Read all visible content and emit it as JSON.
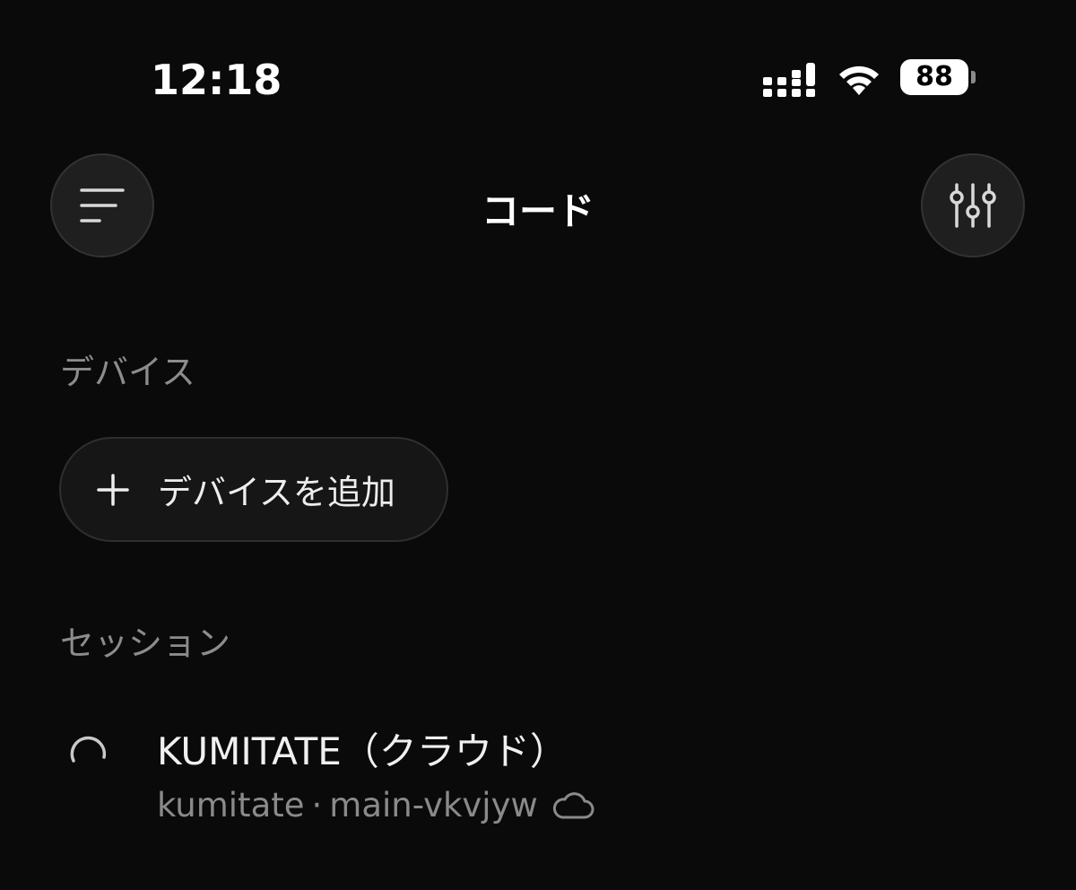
{
  "status_bar": {
    "time": "12:18",
    "battery_level": "88",
    "icons": [
      "signal-icon",
      "wifi-icon",
      "battery-icon"
    ]
  },
  "header": {
    "title": "コード",
    "menu_icon": "menu-icon",
    "filter_icon": "sliders-icon"
  },
  "devices": {
    "section_label": "デバイス",
    "add_button_label": "デバイスを追加",
    "add_icon": "plus-icon"
  },
  "sessions": {
    "section_label": "セッション",
    "items": [
      {
        "name": "KUMITATE（クラウド）",
        "repo": "kumitate",
        "separator": "·",
        "branch": "main-vkvjyw",
        "status_icon": "loading-spinner-icon",
        "location_icon": "cloud-icon"
      }
    ]
  },
  "colors": {
    "background": "#0a0a0a",
    "text_primary": "#f5f5f5",
    "text_secondary": "#8c8c8c",
    "button_bg": "#1f1f1f"
  }
}
